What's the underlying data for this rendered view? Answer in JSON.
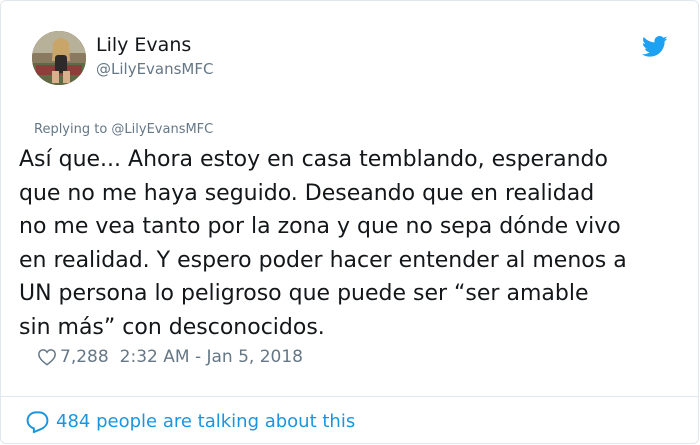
{
  "author": {
    "name": "Lily Evans",
    "handle": "@LilyEvansMFC"
  },
  "icons": {
    "platform": "twitter-bird-icon",
    "like": "heart-icon",
    "conversation": "speech-bubble-icon"
  },
  "colors": {
    "brand": "#1da1f2",
    "link": "#1b95e0",
    "text": "#14171a",
    "muted": "#657786"
  },
  "tweet": {
    "replying_to": "Replying to @LilyEvansMFC",
    "lines": [
      "Así que... Ahora estoy en casa temblando, esperando",
      "que no me haya seguido. Deseando que en realidad",
      "no me vea tanto por la zona y que no sepa dónde vivo",
      "en realidad. Y espero poder hacer entender al menos a",
      "UN persona lo peligroso que puede ser “ser amable",
      "sin más” con desconocidos."
    ],
    "likes": "7,288",
    "timestamp": "2:32 AM - Jan 5, 2018"
  },
  "footer": {
    "conversation_label": "484 people are talking about this"
  }
}
